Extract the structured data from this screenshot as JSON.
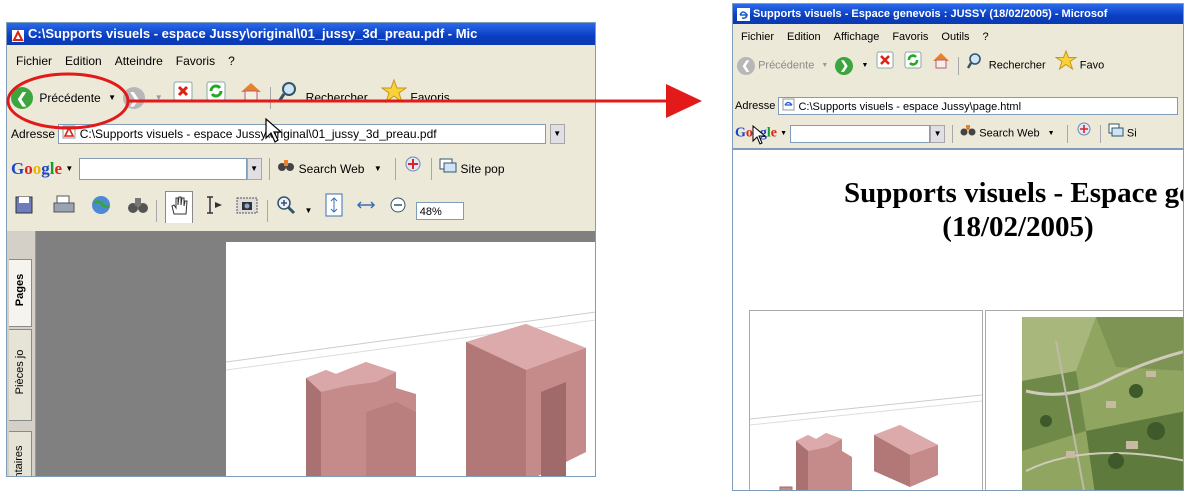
{
  "left_window": {
    "title": "C:\\Supports visuels - espace Jussy\\original\\01_jussy_3d_preau.pdf - Mic",
    "menu": [
      "Fichier",
      "Edition",
      "Atteindre",
      "Favoris",
      "?"
    ],
    "toolbar": {
      "back_label": "Précédente",
      "search_label": "Rechercher",
      "favorites_label": "Favoris"
    },
    "address": {
      "label": "Adresse",
      "value": "C:\\Supports visuels - espace Jussy\\original\\01_jussy_3d_preau.pdf"
    },
    "google_bar": {
      "logo": "Google",
      "search_web": "Search Web",
      "site_pop": "Site pop"
    },
    "acrobat": {
      "zoom": "48%"
    },
    "side_tabs": [
      "Pages",
      "Pièces jo",
      "ntaires"
    ]
  },
  "right_window": {
    "title": "Supports visuels - Espace genevois : JUSSY (18/02/2005) - Microsof",
    "menu": [
      "Fichier",
      "Edition",
      "Affichage",
      "Favoris",
      "Outils",
      "?"
    ],
    "toolbar": {
      "back_label": "Précédente",
      "search_label": "Rechercher",
      "favorites_label": "Favo"
    },
    "address": {
      "label": "Adresse",
      "value": "C:\\Supports visuels - espace Jussy\\page.html"
    },
    "google_bar": {
      "logo": "Google",
      "search_web": "Search Web",
      "site_pop": "Si"
    },
    "page": {
      "heading_line1": "Supports visuels - Espace ge",
      "heading_line2": "(18/02/2005)"
    }
  },
  "colors": {
    "annotation_red": "#e21a1a",
    "building": "#c58a8a",
    "titlebar_blue": "#0a3ec2",
    "chrome": "#ece9d8"
  }
}
